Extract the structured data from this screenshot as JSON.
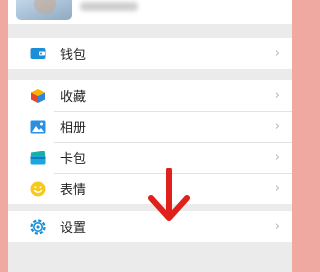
{
  "profile": {
    "avatar": "avatar-photo"
  },
  "menu": {
    "wallet": {
      "label": "钱包",
      "icon": "wallet-icon"
    },
    "favorites": {
      "label": "收藏",
      "icon": "favorites-cube-icon"
    },
    "album": {
      "label": "相册",
      "icon": "photo-album-icon"
    },
    "cards": {
      "label": "卡包",
      "icon": "card-package-icon"
    },
    "stickers": {
      "label": "表情",
      "icon": "smiley-icon"
    },
    "settings": {
      "label": "设置",
      "icon": "gear-icon"
    }
  },
  "chevron": "›",
  "annotation": {
    "icon": "red-down-arrow",
    "color": "#e0201b"
  },
  "colors": {
    "background": "#ebebeb",
    "accent_blue": "#1a8fd6"
  }
}
